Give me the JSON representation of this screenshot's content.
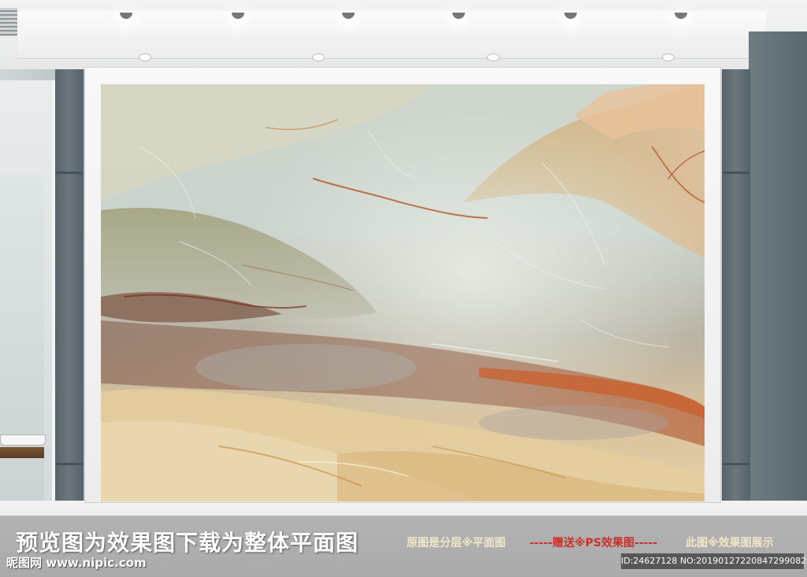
{
  "banner": {
    "headline": "预览图为效果图下载为整体平面图",
    "note_original": "原图是分层※平面图",
    "note_gift": "-----赠送※PS效果图-----",
    "note_effect": "此图※效果图展示",
    "watermark": "昵图网 www.nipic.com",
    "id_line": "ID:24627128 NO:20190127220847299082"
  },
  "colors": {
    "headline": "#ffffff",
    "note_original": "#f2e6c8",
    "note_gift": "#c8322b",
    "note_effect": "#f2e6c8",
    "marble_warm": "#d9a35f",
    "marble_cool": "#c5d3ce",
    "marble_vein": "#b4542a"
  },
  "scene": {
    "subject": "marble-texture-mural",
    "icons": [
      "spotlight-icon",
      "downlight-icon"
    ]
  }
}
